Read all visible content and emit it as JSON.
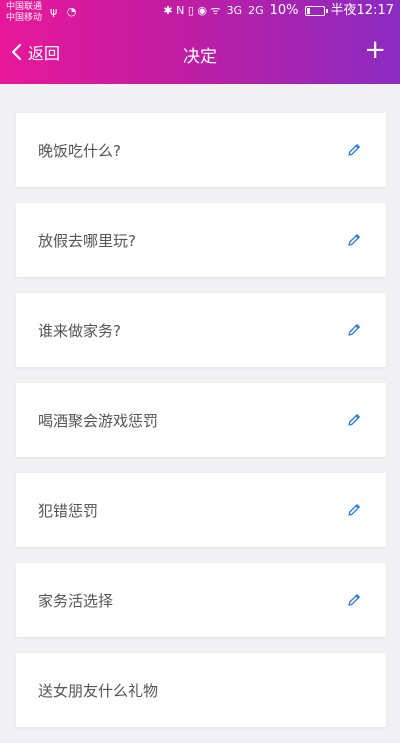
{
  "status_bar": {
    "carrier_1": "中国联通",
    "carrier_2": "中国移动",
    "left_icons": "ψ ◔",
    "icons": "✱ N ▯ ◉ ᯤ",
    "net_1": "3G",
    "net_2": "2G",
    "battery": "10%",
    "time": "半夜12:17"
  },
  "header": {
    "back_label": "返回",
    "title": "决定",
    "add_label": "+"
  },
  "decisions": [
    "晚饭吃什么?",
    "放假去哪里玩?",
    "谁来做家务?",
    "喝酒聚会游戏惩罚",
    "犯错惩罚",
    "家务活选择",
    "送女朋友什么礼物"
  ],
  "colors": {
    "gradient_start": "#e8179a",
    "gradient_end": "#8a2bc1",
    "edit_icon": "#2a7bd1"
  }
}
